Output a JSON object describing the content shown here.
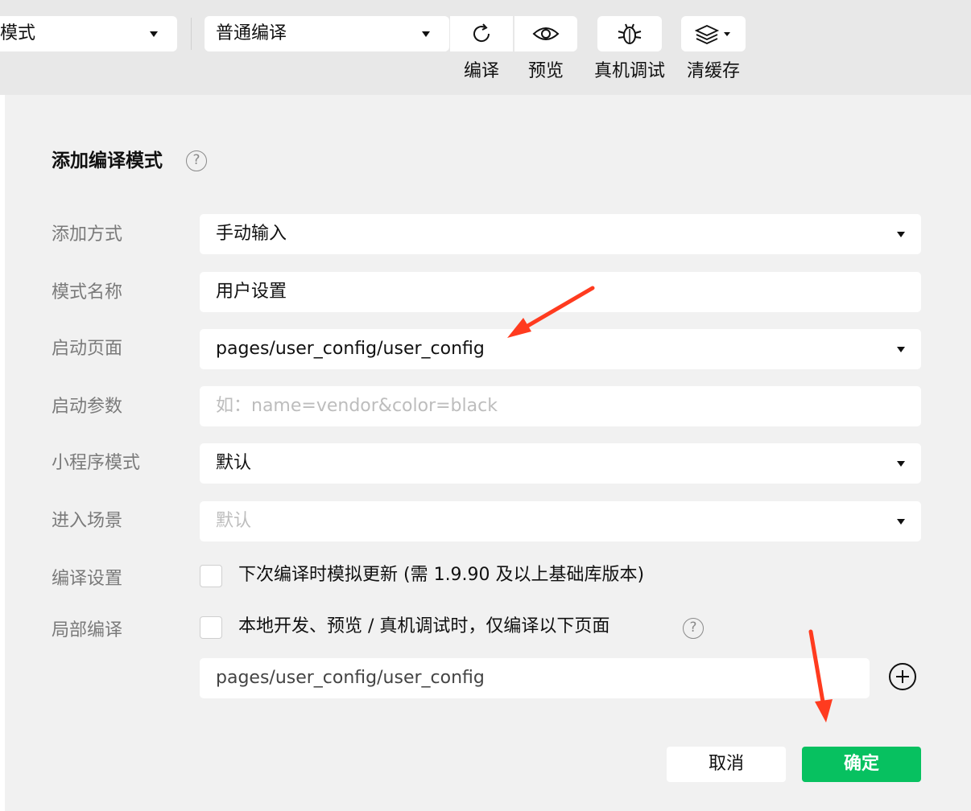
{
  "toolbar": {
    "mode_select": "模式",
    "compile_select": "普通编译",
    "buttons": [
      {
        "label": "编译",
        "icon": "refresh-icon"
      },
      {
        "label": "预览",
        "icon": "eye-icon"
      },
      {
        "label": "真机调试",
        "icon": "bug-icon"
      },
      {
        "label": "清缓存",
        "icon": "layers-icon"
      }
    ]
  },
  "dialog": {
    "title": "添加编译模式",
    "help": "?",
    "rows": {
      "add_method": {
        "label": "添加方式",
        "value": "手动输入"
      },
      "mode_name": {
        "label": "模式名称",
        "value": "用户设置"
      },
      "launch_page": {
        "label": "启动页面",
        "value": "pages/user_config/user_config"
      },
      "launch_params": {
        "label": "启动参数",
        "placeholder": "如：name=vendor&color=black"
      },
      "mini_mode": {
        "label": "小程序模式",
        "value": "默认"
      },
      "scene": {
        "label": "进入场景",
        "placeholder": "默认"
      },
      "compile_settings": {
        "label": "编译设置",
        "checkbox_text": "下次编译时模拟更新 (需 1.9.90 及以上基础库版本)"
      },
      "partial_compile": {
        "label": "局部编译",
        "checkbox_text": "本地开发、预览 / 真机调试时，仅编译以下页面",
        "page_value": "pages/user_config/user_config"
      }
    },
    "cancel_label": "取消",
    "ok_label": "确定"
  },
  "colors": {
    "primary_green": "#07c160",
    "arrow_red": "#ff3b1f"
  }
}
